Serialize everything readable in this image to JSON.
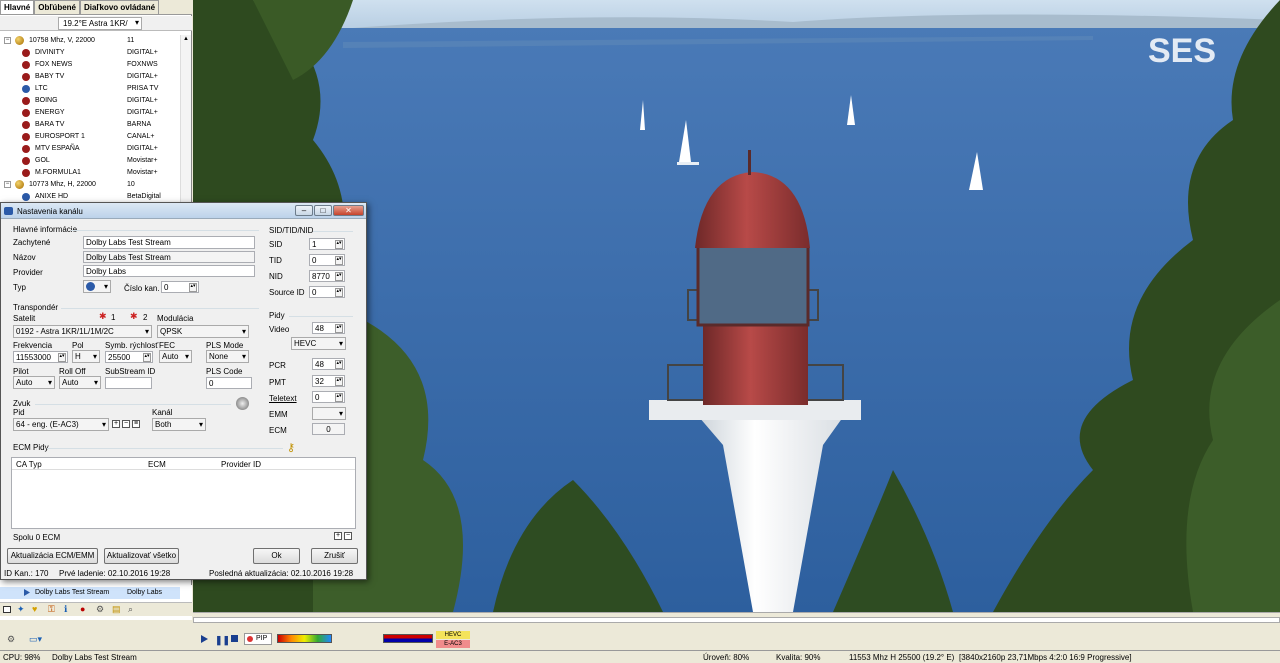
{
  "left_panel": {
    "tabs": [
      "Hlavné",
      "Obľúbené",
      "Diaľkovo ovládané"
    ],
    "satellite": "19.2°E Astra 1KR/",
    "rows": [
      {
        "kind": "tp",
        "name": "10758 Mhz, V, 22000",
        "prov": "11"
      },
      {
        "kind": "ch",
        "name": "DIVINITY",
        "prov": "DIGITAL+"
      },
      {
        "kind": "ch",
        "name": "FOX NEWS",
        "prov": "FOXNWS"
      },
      {
        "kind": "ch",
        "name": "BABY TV",
        "prov": "DIGITAL+"
      },
      {
        "kind": "ch",
        "name": "LTC",
        "prov": "PRISA TV",
        "icon": "blue"
      },
      {
        "kind": "ch",
        "name": "BOING",
        "prov": "DIGITAL+"
      },
      {
        "kind": "ch",
        "name": "ENERGY",
        "prov": "DIGITAL+"
      },
      {
        "kind": "ch",
        "name": "BARA TV",
        "prov": "BARNA"
      },
      {
        "kind": "ch",
        "name": "EUROSPORT 1",
        "prov": "CANAL+"
      },
      {
        "kind": "ch",
        "name": "MTV ESPAÑA",
        "prov": "DIGITAL+"
      },
      {
        "kind": "ch",
        "name": "GOL",
        "prov": "Movistar+"
      },
      {
        "kind": "ch",
        "name": "M.FORMULA1",
        "prov": "Movistar+"
      },
      {
        "kind": "tp",
        "name": "10773 Mhz, H, 22000",
        "prov": "10"
      },
      {
        "kind": "ch",
        "name": "ANIXE HD",
        "prov": "BetaDigital",
        "icon": "blue"
      }
    ],
    "selected": {
      "name": "Dolby Labs Test Stream",
      "prov": "Dolby Labs"
    }
  },
  "dialog": {
    "title": "Nastavenia kanálu",
    "main_info": "Hlavné informácie",
    "captured_label": "Zachytené",
    "captured_value": "Dolby Labs Test Stream",
    "name_label": "Názov",
    "name_value": "Dolby Labs Test Stream",
    "provider_label": "Provider",
    "provider_value": "Dolby Labs",
    "type_label": "Typ",
    "chnum_label": "Číslo kan.",
    "chnum_value": "0",
    "transponder": "Transpondér",
    "satellite_label": "Satelit",
    "lnb1": "1",
    "lnb2": "2",
    "modulation_label": "Modulácia",
    "satellite_value": "0192 - Astra 1KR/1L/1M/2C",
    "modulation_value": "QPSK",
    "freq_label": "Frekvencia",
    "pol_label": "Pol",
    "symrate_label": "Symb. rýchlosť",
    "fec_label": "FEC",
    "plsmode_label": "PLS Mode",
    "freq_value": "11553000",
    "pol_value": "H",
    "symrate_value": "25500",
    "fec_value": "Auto",
    "plsmode_value": "None",
    "pilot_label": "Pilot",
    "rolloff_label": "Roll Off",
    "substream_label": "SubStream ID",
    "plscode_label": "PLS Code",
    "pilot_value": "Auto",
    "rolloff_value": "Auto",
    "plscode_value": "0",
    "audio": "Zvuk",
    "pid_label": "Pid",
    "channel_label": "Kanál",
    "pid_value": "64  - eng. (E-AC3)",
    "channel_value": "Both",
    "ecm_pids": "ECM Pidy",
    "col_catyp": "CA Typ",
    "col_ecm": "ECM",
    "col_provid": "Provider ID",
    "total_ecm": "Spolu 0 ECM",
    "btn_update_ecm": "Aktualizácia ECM/EMM",
    "btn_update_all": "Aktualizovať všetko",
    "btn_ok": "Ok",
    "btn_cancel": "Zrušiť",
    "sid_group": "SID/TID/NID",
    "sid_label": "SID",
    "sid_value": "1",
    "tid_label": "TID",
    "tid_value": "0",
    "nid_label": "NID",
    "nid_value": "8770",
    "srcid_label": "Source ID",
    "srcid_value": "0",
    "pids_group": "Pidy",
    "video_label": "Video",
    "video_value": "48",
    "codec_value": "HEVC",
    "pcr_label": "PCR",
    "pcr_value": "48",
    "pmt_label": "PMT",
    "pmt_value": "32",
    "teletext_label": "Teletext",
    "teletext_value": "0",
    "emm_label": "EMM",
    "ecm_label": "ECM",
    "ecm_value": "0",
    "footer_id": "ID Kan.: 170",
    "footer_first": "Prvé ladenie: 02.10.2016 19:28",
    "footer_last": "Posledná aktualizácia: 02.10.2016 19:28"
  },
  "video": {
    "logo": "SES"
  },
  "controls": {
    "pip": "PIP",
    "badge_video": "HEVC",
    "badge_audio": "E-AC3"
  },
  "status": {
    "cpu": "CPU: 98%",
    "channel": "Dolby Labs Test Stream",
    "level": "Úroveň: 80%",
    "quality": "Kvalita: 90%",
    "tp": "11553 Mhz  H  25500  (19.2° E)",
    "stream": "[3840x2160p  23,71Mbps 4:2:0  16:9 Progressive]"
  },
  "colors": {
    "accent": "#3399ff",
    "titlebar": "#bcd2ea"
  }
}
